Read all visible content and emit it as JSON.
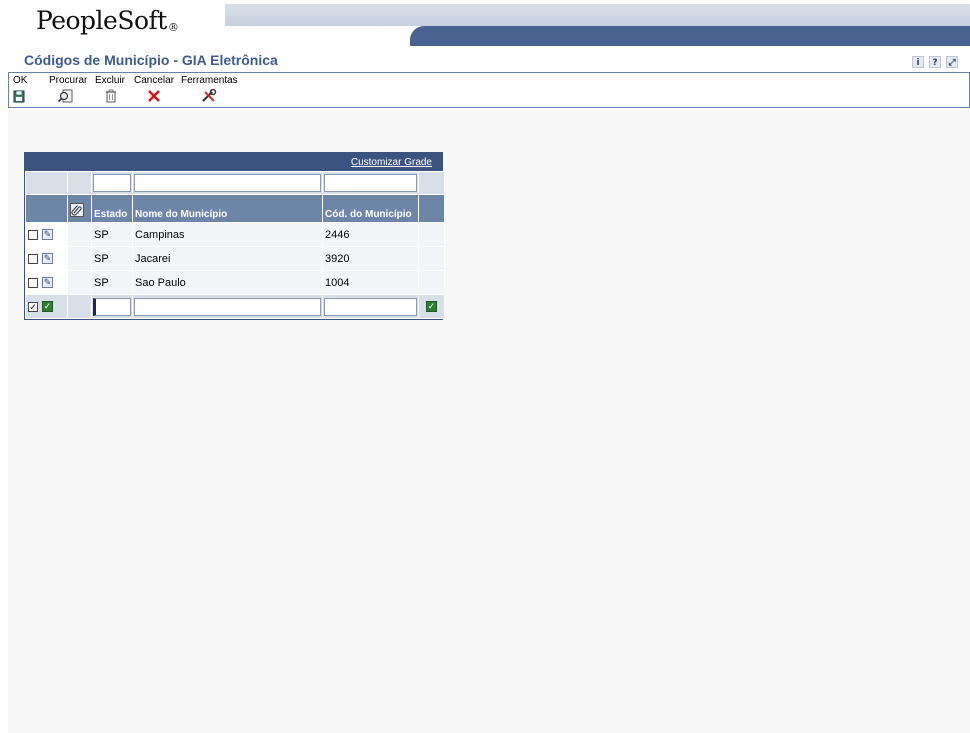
{
  "app": {
    "logo_text": "PeopleSoft",
    "logo_mark": "®",
    "banner_icons": [
      {
        "name": "info-icon",
        "glyph": "i"
      },
      {
        "name": "help-icon",
        "glyph": "?"
      },
      {
        "name": "exit-icon",
        "glyph": "⤢"
      }
    ]
  },
  "page": {
    "title": "Códigos de Município - GIA Eletrônica"
  },
  "toolbar": {
    "ok_label": "OK",
    "find_label": "Procurar",
    "delete_label": "Excluir",
    "cancel_label": "Cancelar",
    "tools_label": "Ferramentas"
  },
  "grid": {
    "customize_link": "Customizar Grade",
    "columns": {
      "state": "Estado",
      "city_name": "Nome do Município",
      "city_code": "Cód. do Município"
    },
    "rows": [
      {
        "state": "SP",
        "city_name": "Campinas",
        "city_code": "2446"
      },
      {
        "state": "SP",
        "city_name": "Jacarei",
        "city_code": "3920"
      },
      {
        "state": "SP",
        "city_name": "Sao Paulo",
        "city_code": "1004"
      }
    ],
    "qbe": {
      "state": "",
      "city_name": "",
      "city_code": ""
    },
    "new_row": {
      "state": "",
      "city_name": "",
      "city_code": ""
    }
  },
  "colors": {
    "banner_bar": "#4a6290",
    "title": "#3e5c8a",
    "grid_header": "#3c5380",
    "column_header": "#6d86a8"
  }
}
